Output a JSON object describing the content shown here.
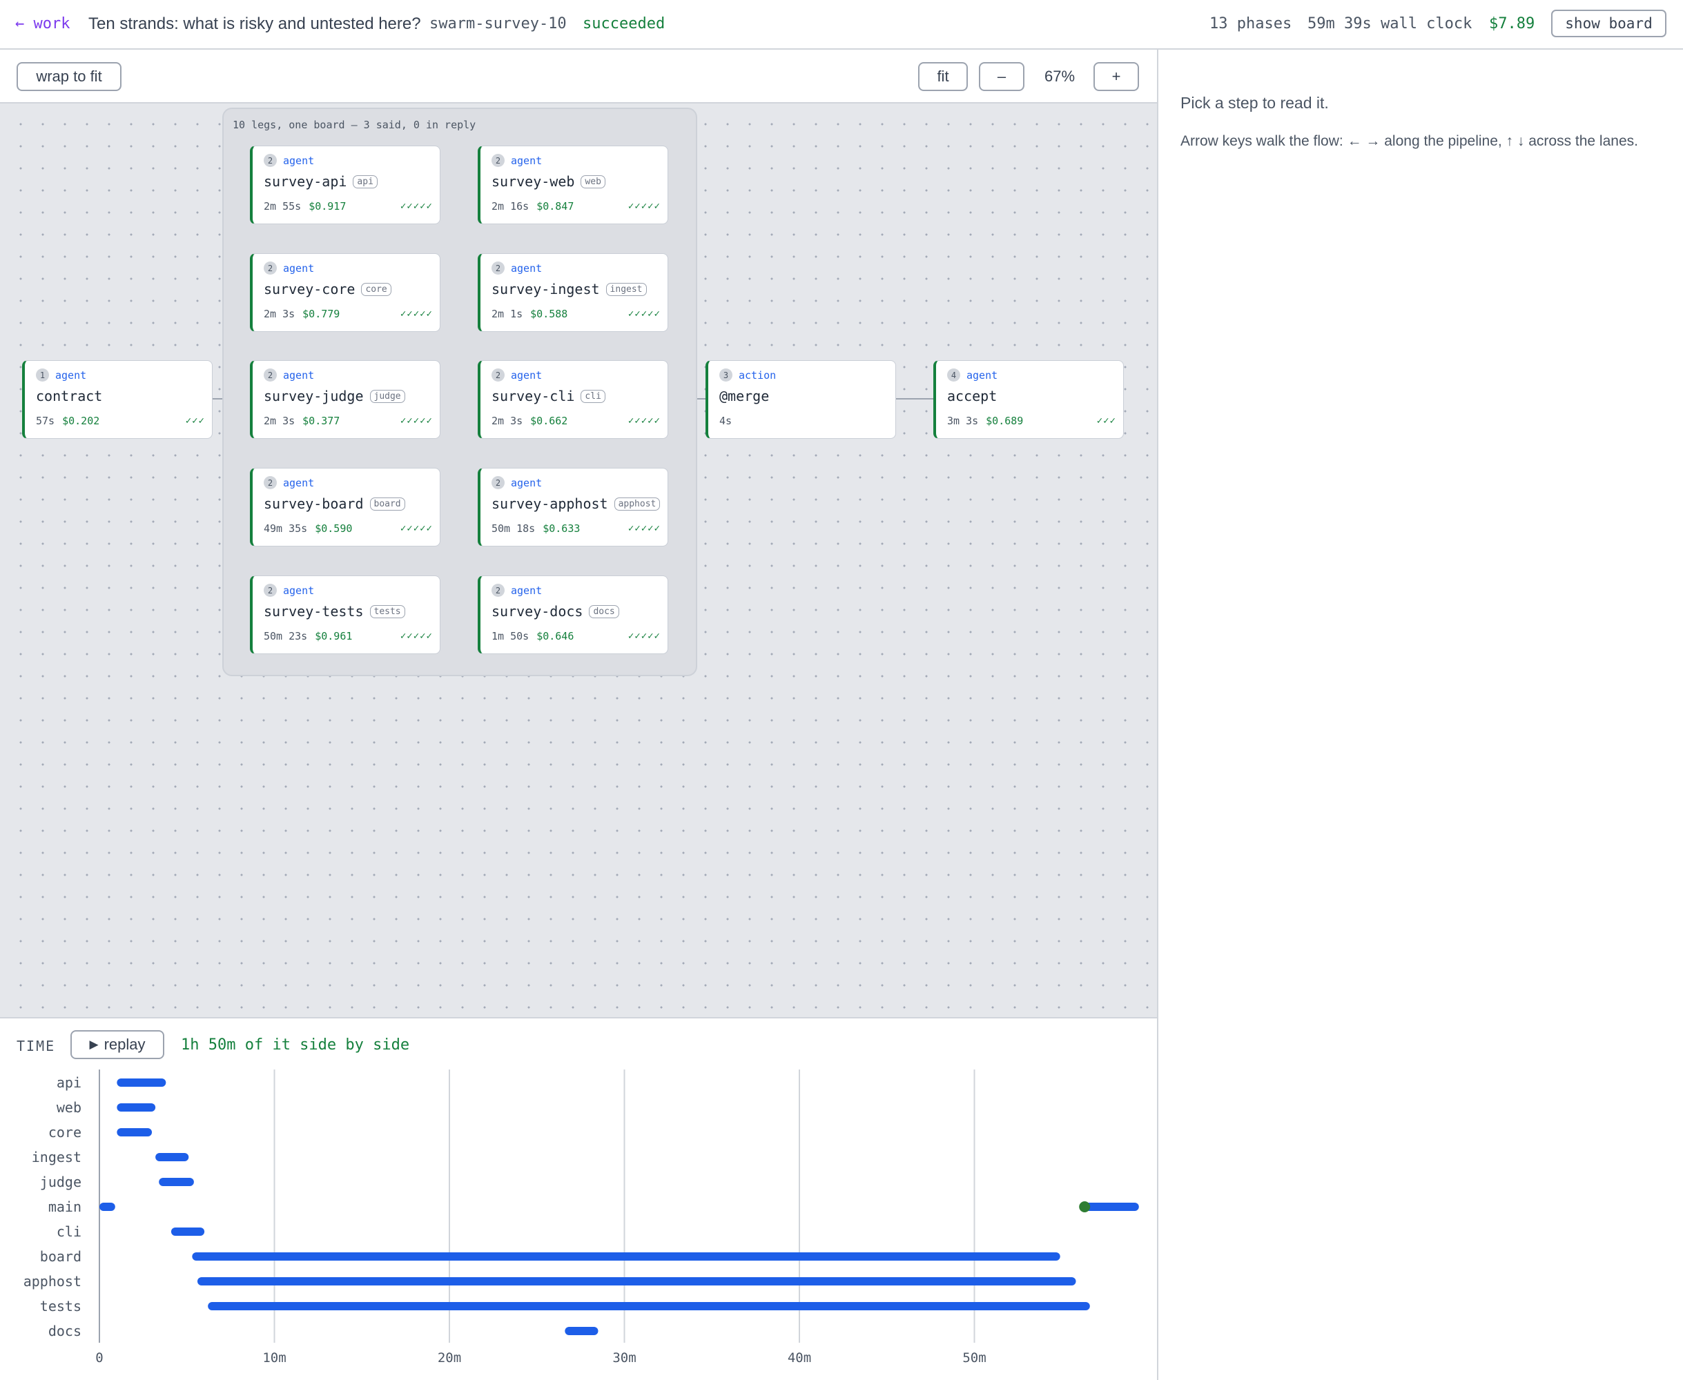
{
  "header": {
    "back_label": "← work",
    "title": "Ten strands: what is risky and untested here?",
    "run_id": "swarm-survey-10",
    "status": "succeeded",
    "phases": "13 phases",
    "wall_clock": "59m 39s wall clock",
    "total_cost": "$7.89",
    "show_board_label": "show board"
  },
  "toolbar": {
    "wrap_label": "wrap to fit",
    "fit_label": "fit",
    "zoom_out_label": "–",
    "zoom_level": "67%",
    "zoom_in_label": "+"
  },
  "group": {
    "label": "10 legs, one board — 3 said, 0 in reply"
  },
  "nodes": [
    {
      "id": "contract",
      "step": "1",
      "kind": "agent",
      "name": "contract",
      "chip": "",
      "duration": "57s",
      "cost": "$0.202",
      "checks": "✓✓✓"
    },
    {
      "id": "survey-api",
      "step": "2",
      "kind": "agent",
      "name": "survey-api",
      "chip": "api",
      "duration": "2m 55s",
      "cost": "$0.917",
      "checks": "✓✓✓✓✓"
    },
    {
      "id": "survey-web",
      "step": "2",
      "kind": "agent",
      "name": "survey-web",
      "chip": "web",
      "duration": "2m 16s",
      "cost": "$0.847",
      "checks": "✓✓✓✓✓"
    },
    {
      "id": "survey-core",
      "step": "2",
      "kind": "agent",
      "name": "survey-core",
      "chip": "core",
      "duration": "2m 3s",
      "cost": "$0.779",
      "checks": "✓✓✓✓✓"
    },
    {
      "id": "survey-ingest",
      "step": "2",
      "kind": "agent",
      "name": "survey-ingest",
      "chip": "ingest",
      "duration": "2m 1s",
      "cost": "$0.588",
      "checks": "✓✓✓✓✓"
    },
    {
      "id": "survey-judge",
      "step": "2",
      "kind": "agent",
      "name": "survey-judge",
      "chip": "judge",
      "duration": "2m 3s",
      "cost": "$0.377",
      "checks": "✓✓✓✓✓"
    },
    {
      "id": "survey-cli",
      "step": "2",
      "kind": "agent",
      "name": "survey-cli",
      "chip": "cli",
      "duration": "2m 3s",
      "cost": "$0.662",
      "checks": "✓✓✓✓✓"
    },
    {
      "id": "survey-board",
      "step": "2",
      "kind": "agent",
      "name": "survey-board",
      "chip": "board",
      "duration": "49m 35s",
      "cost": "$0.590",
      "checks": "✓✓✓✓✓"
    },
    {
      "id": "survey-apphost",
      "step": "2",
      "kind": "agent",
      "name": "survey-apphost",
      "chip": "apphost",
      "duration": "50m 18s",
      "cost": "$0.633",
      "checks": "✓✓✓✓✓"
    },
    {
      "id": "survey-tests",
      "step": "2",
      "kind": "agent",
      "name": "survey-tests",
      "chip": "tests",
      "duration": "50m 23s",
      "cost": "$0.961",
      "checks": "✓✓✓✓✓"
    },
    {
      "id": "survey-docs",
      "step": "2",
      "kind": "agent",
      "name": "survey-docs",
      "chip": "docs",
      "duration": "1m 50s",
      "cost": "$0.646",
      "checks": "✓✓✓✓✓"
    },
    {
      "id": "merge",
      "step": "3",
      "kind": "action",
      "name": "@merge",
      "chip": "",
      "duration": "4s",
      "cost": "",
      "checks": ""
    },
    {
      "id": "accept",
      "step": "4",
      "kind": "agent",
      "name": "accept",
      "chip": "",
      "duration": "3m 3s",
      "cost": "$0.689",
      "checks": "✓✓✓"
    }
  ],
  "side_panel": {
    "heading": "Pick a step to read it.",
    "hint": "Arrow keys walk the flow: ← → along the pipeline, ↑ ↓ across the lanes."
  },
  "timeline": {
    "label": "TIME",
    "replay_label": "replay",
    "summary": "1h 50m of it side by side",
    "bar_color": "#1d5ee8",
    "marker_color": "#2e7d32",
    "chart_data": {
      "type": "gantt",
      "x_unit": "minutes",
      "xlim": [
        0,
        59.65
      ],
      "x_ticks": [
        0,
        10,
        20,
        30,
        40,
        50
      ],
      "x_tick_labels": [
        "0",
        "10m",
        "20m",
        "30m",
        "40m",
        "50m"
      ],
      "grid": true,
      "lanes": [
        {
          "name": "api",
          "spans": [
            [
              1.0,
              3.8
            ]
          ]
        },
        {
          "name": "web",
          "spans": [
            [
              1.0,
              3.2
            ]
          ]
        },
        {
          "name": "core",
          "spans": [
            [
              1.0,
              3.0
            ]
          ]
        },
        {
          "name": "ingest",
          "spans": [
            [
              3.2,
              5.1
            ]
          ]
        },
        {
          "name": "judge",
          "spans": [
            [
              3.4,
              5.4
            ]
          ]
        },
        {
          "name": "main",
          "spans": [
            [
              0.0,
              0.9
            ],
            [
              56.3,
              59.4
            ]
          ],
          "markers": [
            56.3
          ]
        },
        {
          "name": "cli",
          "spans": [
            [
              4.1,
              6.0
            ]
          ]
        },
        {
          "name": "board",
          "spans": [
            [
              5.3,
              54.9
            ]
          ]
        },
        {
          "name": "apphost",
          "spans": [
            [
              5.6,
              55.8
            ]
          ]
        },
        {
          "name": "tests",
          "spans": [
            [
              6.2,
              56.6
            ]
          ]
        },
        {
          "name": "docs",
          "spans": [
            [
              26.6,
              28.5
            ]
          ]
        }
      ]
    }
  }
}
